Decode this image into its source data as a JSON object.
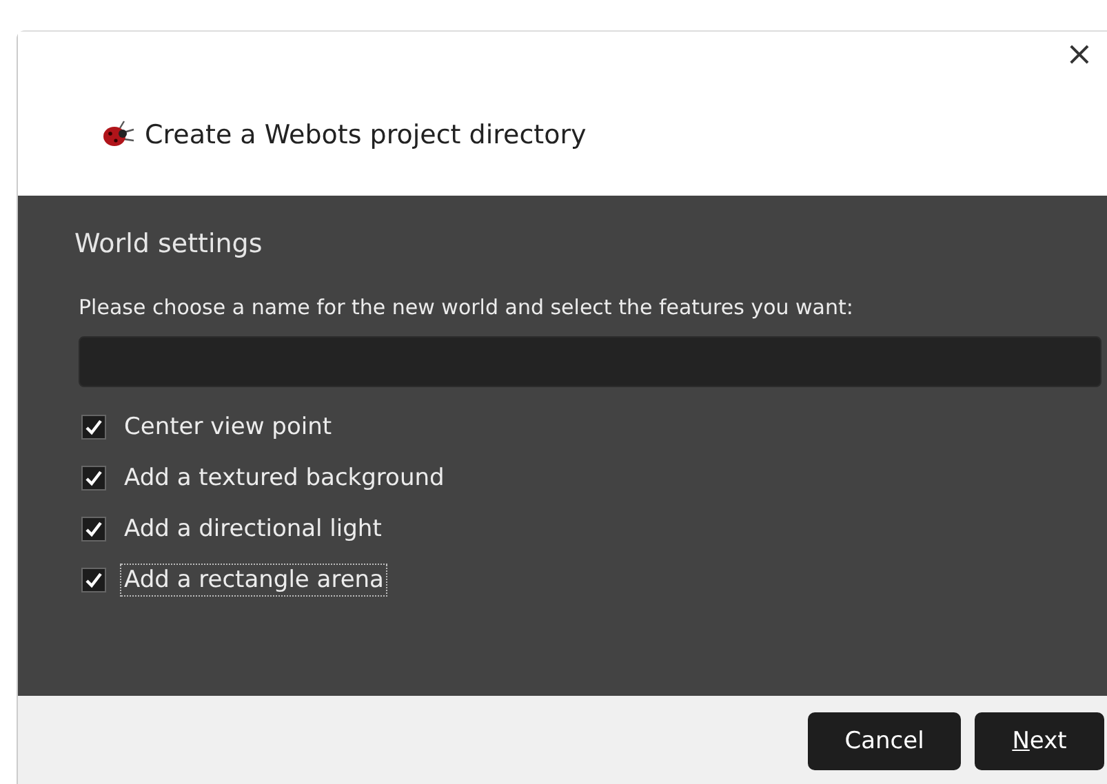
{
  "window": {
    "title": "Create a Webots project directory",
    "close": "×"
  },
  "page": {
    "heading": "World settings",
    "instruction": "Please choose a name for the new world and select the features you want:",
    "options": [
      {
        "label": "Center view point",
        "checked": true,
        "focused": false
      },
      {
        "label": "Add a textured background",
        "checked": true,
        "focused": false
      },
      {
        "label": "Add a directional light",
        "checked": true,
        "focused": false
      },
      {
        "label": "Add a rectangle arena",
        "checked": true,
        "focused": true
      }
    ]
  },
  "buttons": [
    {
      "label": "Cancel",
      "mnemonic": false
    },
    {
      "label": "Next",
      "mnemonic": true
    }
  ]
}
